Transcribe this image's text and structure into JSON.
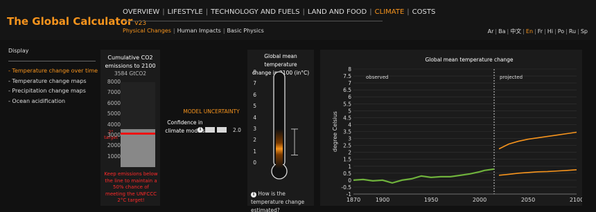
{
  "app": {
    "title": "The Global Calculator",
    "version": "v23"
  },
  "nav": {
    "items": [
      "OVERVIEW",
      "LIFESTYLE",
      "TECHNOLOGY AND FUELS",
      "LAND AND FOOD",
      "CLIMATE",
      "COSTS"
    ],
    "active": "CLIMATE"
  },
  "subnav": {
    "items": [
      "Physical Changes",
      "Human Impacts",
      "Basic Physics"
    ],
    "active": "Physical Changes"
  },
  "languages": {
    "items": [
      "Ar",
      "Ba",
      "中文",
      "En",
      "Fr",
      "Hi",
      "Po",
      "Ru",
      "Sp"
    ],
    "active": "En"
  },
  "sidebar": {
    "title": "Display",
    "items": [
      "- Temperature change over time",
      "- Temperature change maps",
      "- Precipitation change maps",
      "- Ocean acidification"
    ],
    "active_index": 0
  },
  "co2": {
    "title_line1": "Cumulative CO2",
    "title_line2": "emissions to 2100",
    "value_label": "3584 GtCO2",
    "value": 3584,
    "ticks": [
      "8000",
      "7000",
      "6000",
      "5000",
      "4000",
      "3000",
      "2000",
      "1000"
    ],
    "axis_max": 8000,
    "target_value": 3200,
    "target_label": "2° target",
    "note": "Keep emissions below the line to maintain a 50% chance of meeting the UNFCCC 2°C target!"
  },
  "uncertainty": {
    "title": "MODEL UNCERTAINTY",
    "label": "Confidence in climate models",
    "value": "2.0"
  },
  "thermometer": {
    "title_line1": "Global mean temperature",
    "title_line2": "change in 2100 (in°C)",
    "ticks": [
      "8",
      "7",
      "6",
      "5",
      "4",
      "3",
      "2",
      "1",
      "0"
    ],
    "mean_value": 2.0,
    "range_low": 0.7,
    "range_high": 3.0,
    "footer": "How is the temperature change estimated?"
  },
  "chart_data": {
    "type": "line",
    "title": "Global mean temperature change",
    "ylabel": "degree Celsius",
    "xlabel": "",
    "xlim": [
      1870,
      2100
    ],
    "ylim": [
      -1,
      8
    ],
    "xticks": [
      "1870",
      "1900",
      "1950",
      "2000",
      "2050",
      "2100"
    ],
    "yticks": [
      "8",
      "7.5",
      "7",
      "6.5",
      "6",
      "5.5",
      "5",
      "4.5",
      "4",
      "3.5",
      "3",
      "2.5",
      "2",
      "1.5",
      "1",
      "0.5",
      "0",
      "-0.5",
      "-1"
    ],
    "divider_x": 2015,
    "annotations": {
      "left": "observed",
      "right": "projected"
    },
    "colors": {
      "observed": "#6fb23c",
      "projected": "#f7941d"
    },
    "series": [
      {
        "kind": "observed",
        "x": [
          1870,
          1880,
          1890,
          1900,
          1910,
          1920,
          1930,
          1940,
          1950,
          1960,
          1970,
          1980,
          1990,
          2000,
          2005,
          2010,
          2015
        ],
        "y": [
          0.0,
          0.05,
          -0.05,
          0.0,
          -0.2,
          0.0,
          0.1,
          0.3,
          0.2,
          0.25,
          0.25,
          0.35,
          0.45,
          0.6,
          0.7,
          0.75,
          0.8
        ]
      },
      {
        "kind": "projected",
        "x": [
          2020,
          2030,
          2040,
          2050,
          2060,
          2070,
          2080,
          2090,
          2100
        ],
        "y": [
          2.25,
          2.6,
          2.8,
          2.95,
          3.05,
          3.15,
          3.25,
          3.35,
          3.45
        ]
      },
      {
        "kind": "projected",
        "x": [
          2020,
          2030,
          2040,
          2050,
          2060,
          2070,
          2080,
          2090,
          2100
        ],
        "y": [
          0.35,
          0.42,
          0.5,
          0.55,
          0.6,
          0.62,
          0.66,
          0.7,
          0.75
        ]
      }
    ]
  }
}
